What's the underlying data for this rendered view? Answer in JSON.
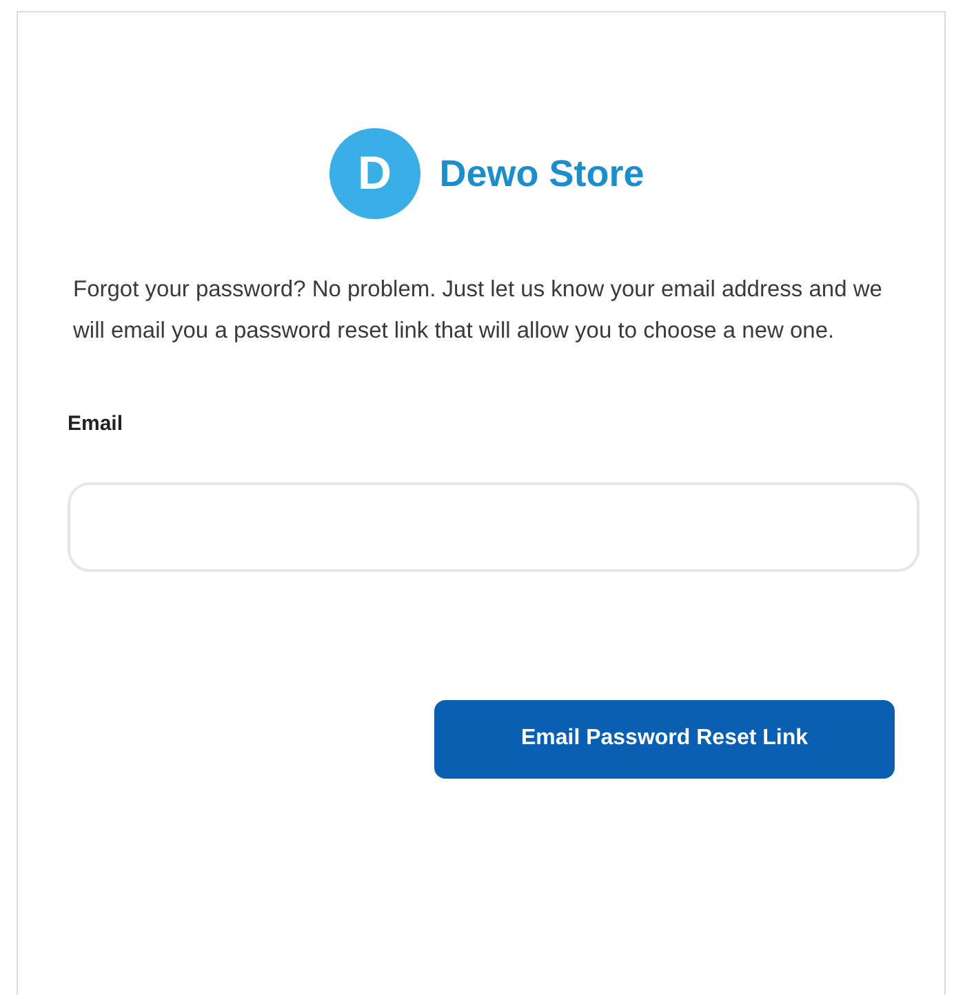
{
  "logo": {
    "letter": "D",
    "name": "Dewo Store"
  },
  "intro": "Forgot your password? No problem. Just let us know your email address and we will email you a password reset link that will allow you to choose a new one.",
  "email_field": {
    "label": "Email"
  },
  "submit_button": {
    "label": "Email Password Reset Link"
  }
}
